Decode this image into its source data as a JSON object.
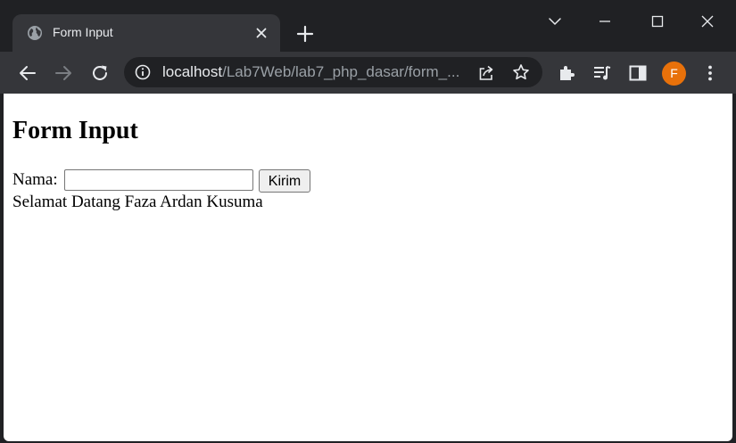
{
  "browser": {
    "tab": {
      "title": "Form Input",
      "favicon": "globe-icon"
    },
    "address_bar": {
      "host": "localhost",
      "path": "/Lab7Web/lab7_php_dasar/form_..."
    },
    "profile_initial": "F",
    "colors": {
      "frame": "#202124",
      "toolbar": "#35363a",
      "avatar": "#e8710a"
    }
  },
  "page": {
    "heading": "Form Input",
    "form": {
      "name_label": "Nama:",
      "name_value": "",
      "submit_label": "Kirim"
    },
    "greeting": "Selamat Datang Faza Ardan Kusuma"
  }
}
